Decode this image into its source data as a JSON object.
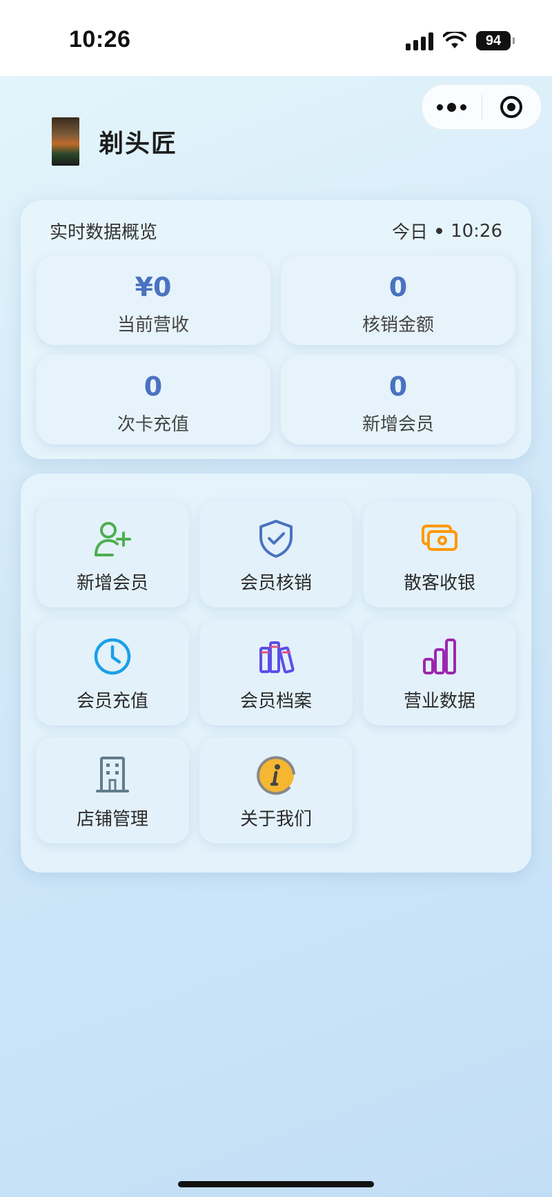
{
  "status_bar": {
    "time": "10:26",
    "battery": "94"
  },
  "header": {
    "shop_name": "剃头匠"
  },
  "overview": {
    "title": "实时数据概览",
    "period": "今日",
    "time": "10:26",
    "stats": [
      {
        "value": "¥0",
        "label": "当前营收"
      },
      {
        "value": "0",
        "label": "核销金额"
      },
      {
        "value": "0",
        "label": "次卡充值"
      },
      {
        "value": "0",
        "label": "新增会员"
      }
    ]
  },
  "menu": {
    "items": [
      {
        "label": "新增会员",
        "icon": "add-user-icon",
        "color": "#4caf50"
      },
      {
        "label": "会员核销",
        "icon": "shield-check-icon",
        "color": "#4a72c0"
      },
      {
        "label": "散客收银",
        "icon": "cash-icon",
        "color": "#ff9800"
      },
      {
        "label": "会员充值",
        "icon": "clock-icon",
        "color": "#1aa0e8"
      },
      {
        "label": "会员档案",
        "icon": "books-icon",
        "color": "#5b4ee8"
      },
      {
        "label": "营业数据",
        "icon": "bar-chart-icon",
        "color": "#9c27b0"
      },
      {
        "label": "店铺管理",
        "icon": "building-icon",
        "color": "#607d8b"
      },
      {
        "label": "关于我们",
        "icon": "info-icon",
        "color": "#f5b731"
      }
    ]
  }
}
